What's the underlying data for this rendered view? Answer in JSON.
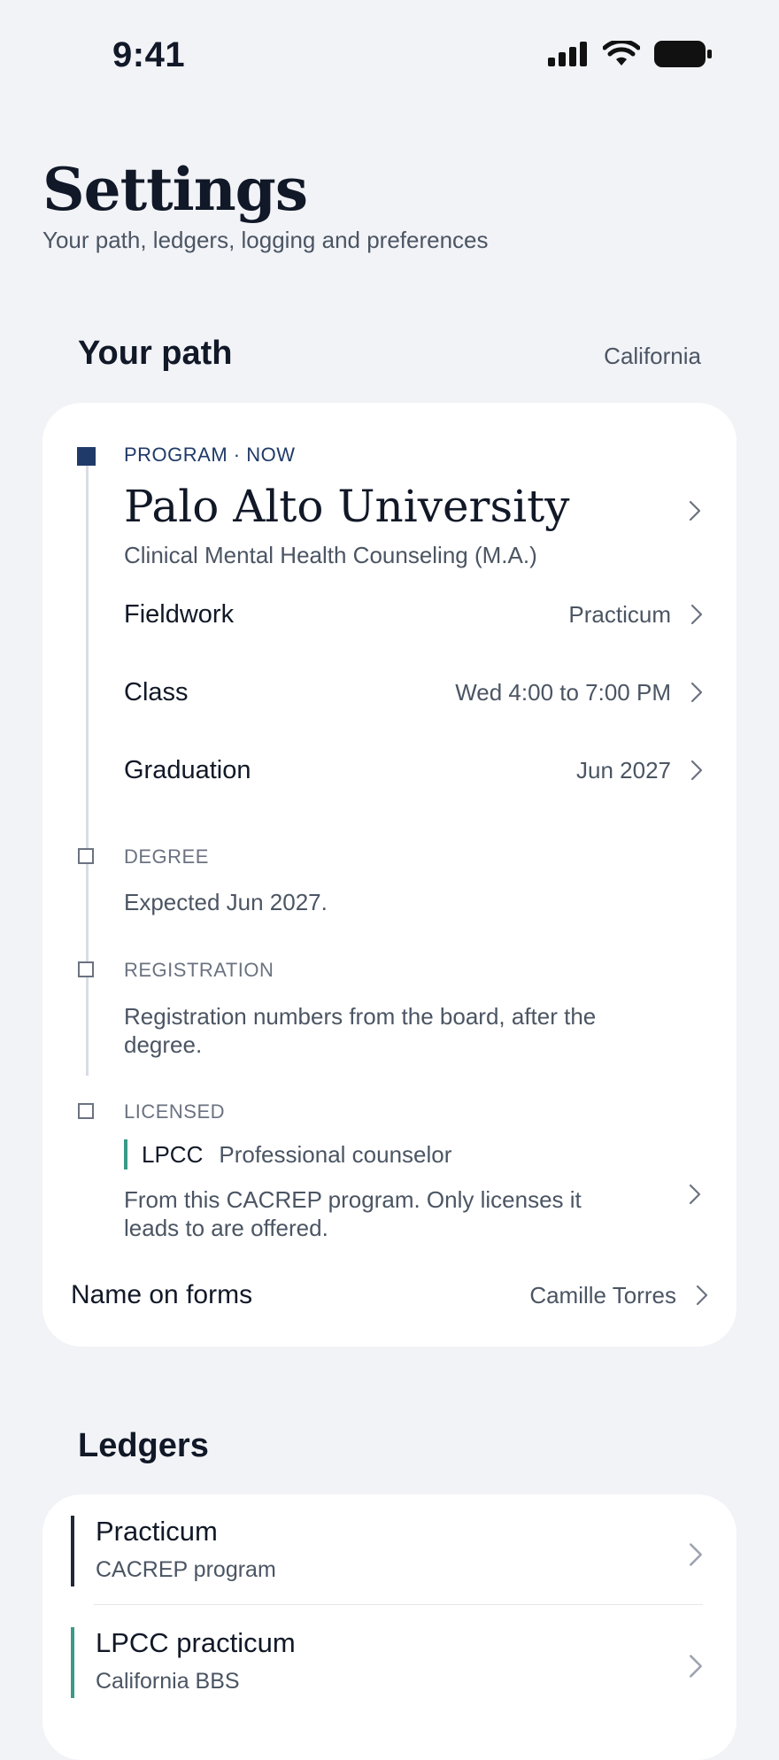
{
  "status": {
    "time": "9:41"
  },
  "page": {
    "title": "Settings",
    "subtitle": "Your path, ledgers, logging and preferences"
  },
  "path_section": {
    "title": "Your path",
    "state": "California",
    "program": {
      "eyebrow": "PROGRAM · NOW",
      "school": "Palo Alto University",
      "degree_name": "Clinical Mental Health Counseling (M.A.)",
      "rows": [
        {
          "label": "Fieldwork",
          "value": "Practicum"
        },
        {
          "label": "Class",
          "value": "Wed 4:00 to 7:00 PM"
        },
        {
          "label": "Graduation",
          "value": "Jun 2027"
        }
      ]
    },
    "degree": {
      "eyebrow": "DEGREE",
      "text": "Expected Jun 2027."
    },
    "registration": {
      "eyebrow": "REGISTRATION",
      "text": "Registration numbers from the board, after the degree."
    },
    "licensed": {
      "eyebrow": "LICENSED",
      "code": "LPCC",
      "name": "Professional counselor",
      "text": "From this CACREP program. Only licenses it leads to are offered."
    },
    "name_on_forms": {
      "label": "Name on forms",
      "value": "Camille Torres"
    }
  },
  "ledgers_section": {
    "title": "Ledgers",
    "items": [
      {
        "title": "Practicum",
        "subtitle": "CACREP program",
        "accent": "#1f2937"
      },
      {
        "title": "LPCC practicum",
        "subtitle": "California BBS",
        "accent": "#3a9a87"
      }
    ]
  },
  "colors": {
    "accent_navy": "#1f3a68",
    "accent_teal": "#3a9a87",
    "background": "#f2f3f7"
  }
}
